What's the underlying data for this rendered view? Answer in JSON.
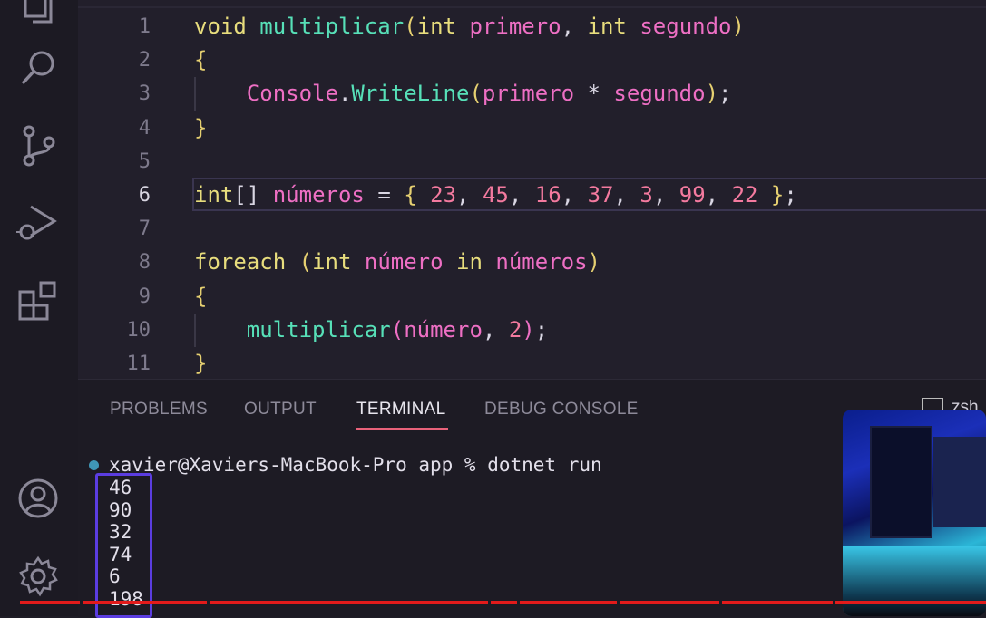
{
  "editor": {
    "lines": [
      {
        "n": "1",
        "tokens": [
          [
            "kw",
            "void"
          ],
          [
            "pn",
            " "
          ],
          [
            "fn",
            "multiplicar"
          ],
          [
            "par",
            "("
          ],
          [
            "kw",
            "int"
          ],
          [
            "pn",
            " "
          ],
          [
            "var",
            "primero"
          ],
          [
            "pn",
            ", "
          ],
          [
            "kw",
            "int"
          ],
          [
            "pn",
            " "
          ],
          [
            "var",
            "segundo"
          ],
          [
            "par",
            ")"
          ]
        ]
      },
      {
        "n": "2",
        "tokens": [
          [
            "par",
            "{"
          ]
        ]
      },
      {
        "n": "3",
        "tokens": [
          [
            "pn",
            "    "
          ],
          [
            "var",
            "Console"
          ],
          [
            "pn",
            "."
          ],
          [
            "fn",
            "WriteLine"
          ],
          [
            "par",
            "("
          ],
          [
            "var",
            "primero"
          ],
          [
            "pn",
            " * "
          ],
          [
            "var",
            "segundo"
          ],
          [
            "par",
            ")"
          ],
          [
            "pn",
            ";"
          ]
        ]
      },
      {
        "n": "4",
        "tokens": [
          [
            "par",
            "}"
          ]
        ]
      },
      {
        "n": "5",
        "tokens": []
      },
      {
        "n": "6",
        "tokens": [
          [
            "kw",
            "int"
          ],
          [
            "pn",
            "[] "
          ],
          [
            "var",
            "números"
          ],
          [
            "pn",
            " = "
          ],
          [
            "par",
            "{ "
          ],
          [
            "num",
            "23"
          ],
          [
            "pn",
            ", "
          ],
          [
            "num",
            "45"
          ],
          [
            "pn",
            ", "
          ],
          [
            "num",
            "16"
          ],
          [
            "pn",
            ", "
          ],
          [
            "num",
            "37"
          ],
          [
            "pn",
            ", "
          ],
          [
            "num",
            "3"
          ],
          [
            "pn",
            ", "
          ],
          [
            "num",
            "99"
          ],
          [
            "pn",
            ", "
          ],
          [
            "num",
            "22"
          ],
          [
            "par",
            " }"
          ],
          [
            "pn",
            ";"
          ]
        ]
      },
      {
        "n": "7",
        "tokens": []
      },
      {
        "n": "8",
        "tokens": [
          [
            "kw",
            "foreach"
          ],
          [
            "pn",
            " "
          ],
          [
            "par",
            "("
          ],
          [
            "kw",
            "int"
          ],
          [
            "pn",
            " "
          ],
          [
            "var",
            "número"
          ],
          [
            "pn",
            " "
          ],
          [
            "kw",
            "in"
          ],
          [
            "pn",
            " "
          ],
          [
            "var",
            "números"
          ],
          [
            "par",
            ")"
          ]
        ]
      },
      {
        "n": "9",
        "tokens": [
          [
            "par",
            "{"
          ]
        ]
      },
      {
        "n": "10",
        "tokens": [
          [
            "pn",
            "    "
          ],
          [
            "fn",
            "multiplicar"
          ],
          [
            "var",
            "("
          ],
          [
            "var",
            "número"
          ],
          [
            "pn",
            ", "
          ],
          [
            "num",
            "2"
          ],
          [
            "var",
            ")"
          ],
          [
            "pn",
            ";"
          ]
        ]
      },
      {
        "n": "11",
        "tokens": [
          [
            "par",
            "}"
          ]
        ]
      }
    ],
    "active_line": "6"
  },
  "panel": {
    "tabs": [
      "PROBLEMS",
      "OUTPUT",
      "TERMINAL",
      "DEBUG CONSOLE"
    ],
    "active_tab": "TERMINAL",
    "shell_label": "zsh"
  },
  "terminal": {
    "prompt": "xavier@Xaviers-MacBook-Pro app % dotnet run",
    "output": [
      "46",
      "90",
      "32",
      "74",
      "6",
      "198"
    ]
  },
  "activity_icons": [
    "explorer-icon",
    "search-icon",
    "source-control-icon",
    "run-debug-icon",
    "extensions-icon",
    "account-icon",
    "settings-gear-icon"
  ],
  "colors": {
    "keyword": "#e8dd7d",
    "function": "#57e0b8",
    "variable": "#ee6fc4",
    "number": "#f47a9f",
    "highlight_box": "#5b3de0",
    "progress_bar": "#e21b1b"
  }
}
